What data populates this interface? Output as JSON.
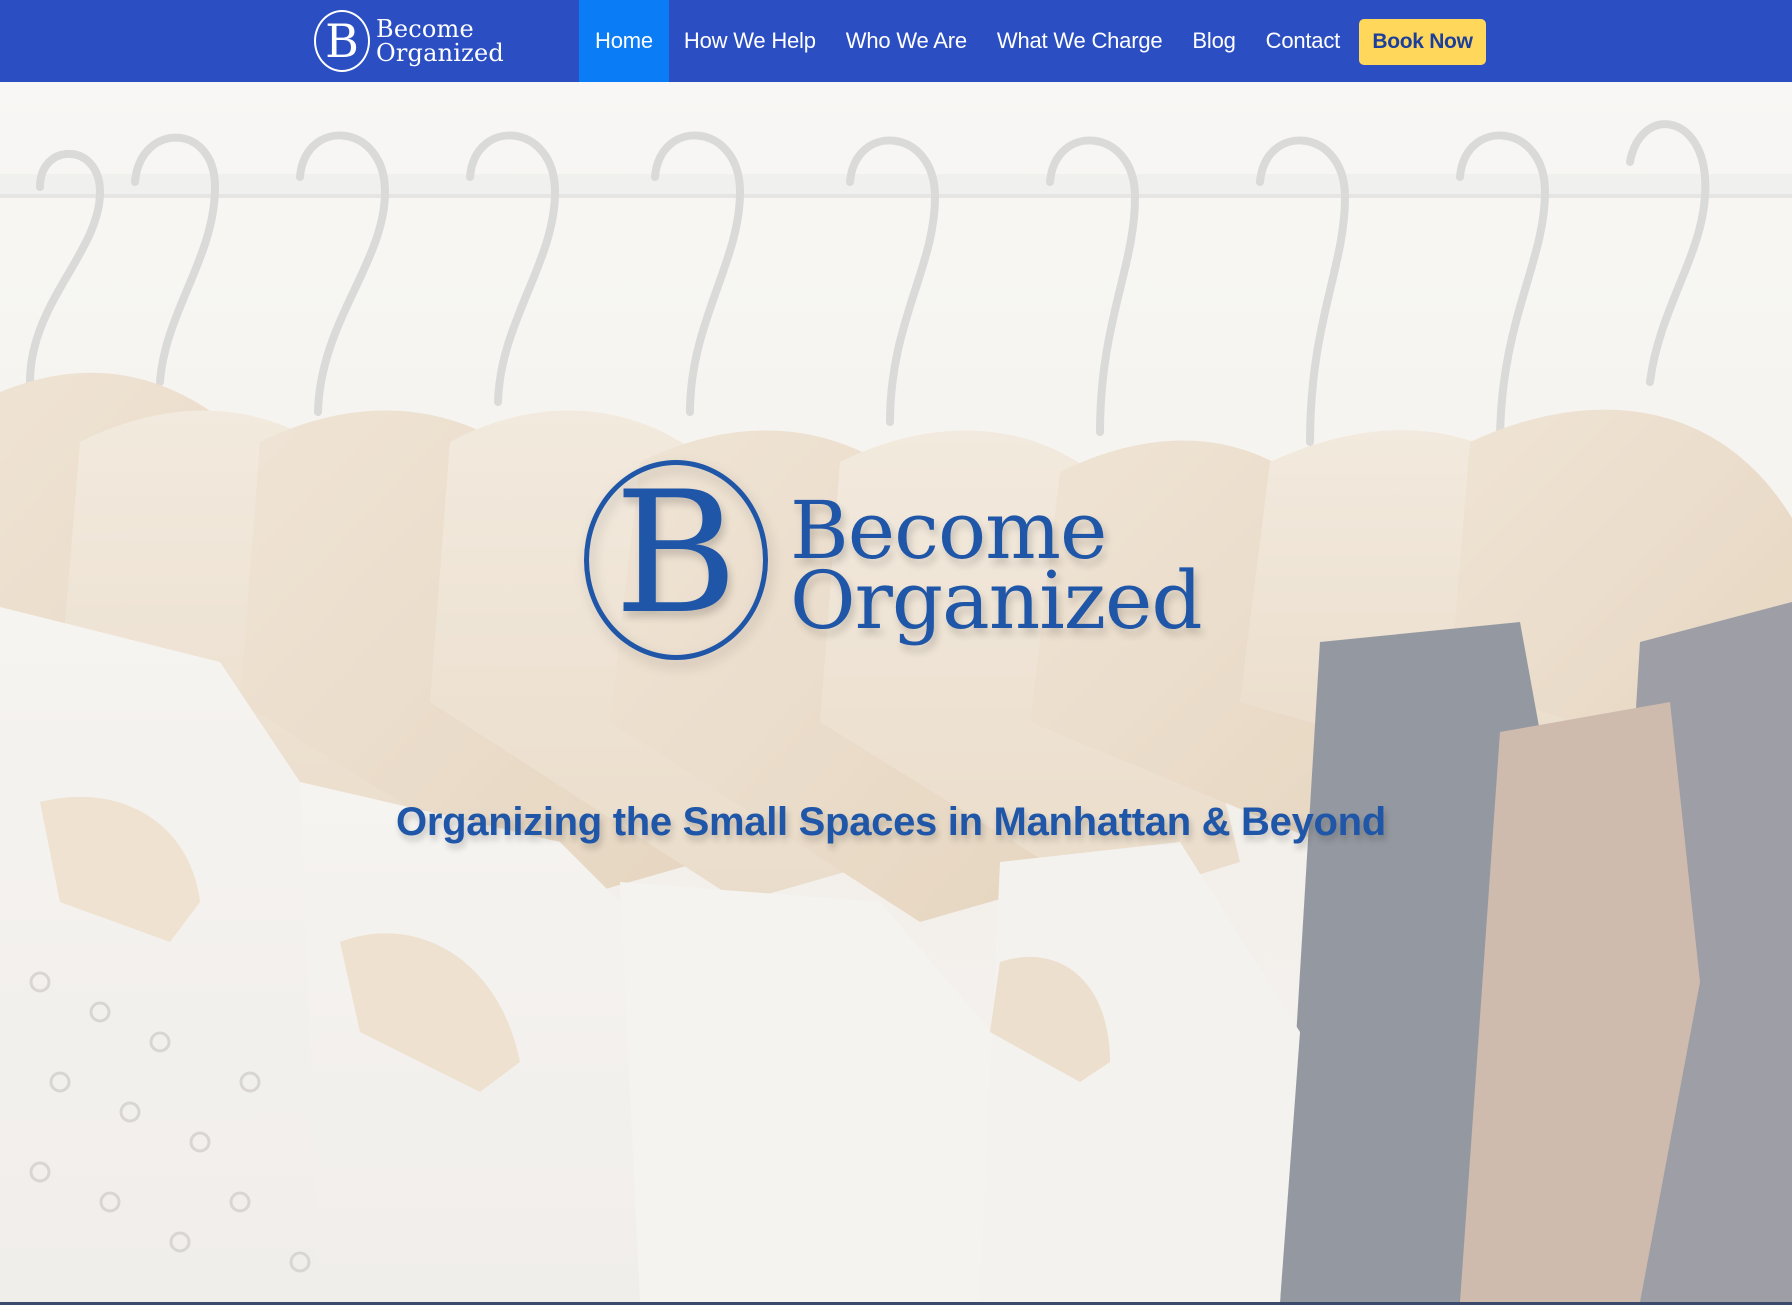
{
  "nav": {
    "logo_line1": "Become",
    "logo_line2": "Organized",
    "logo_letter": "B",
    "items": [
      {
        "label": "Home",
        "active": true
      },
      {
        "label": "How We Help",
        "active": false
      },
      {
        "label": "Who We Are",
        "active": false
      },
      {
        "label": "What We Charge",
        "active": false
      },
      {
        "label": "Blog",
        "active": false
      },
      {
        "label": "Contact",
        "active": false
      }
    ],
    "cta_label": "Book Now"
  },
  "hero": {
    "logo_letter": "B",
    "logo_line1": "Become",
    "logo_line2": "Organized",
    "tagline": "Organizing the Small Spaces in Manhattan & Beyond",
    "background_image": "clothes-on-hangers-photo"
  },
  "colors": {
    "nav_bg": "#2b4fc3",
    "nav_active": "#0a7cf5",
    "cta_bg": "#ffd75a",
    "brand_blue": "#1f56a8"
  }
}
